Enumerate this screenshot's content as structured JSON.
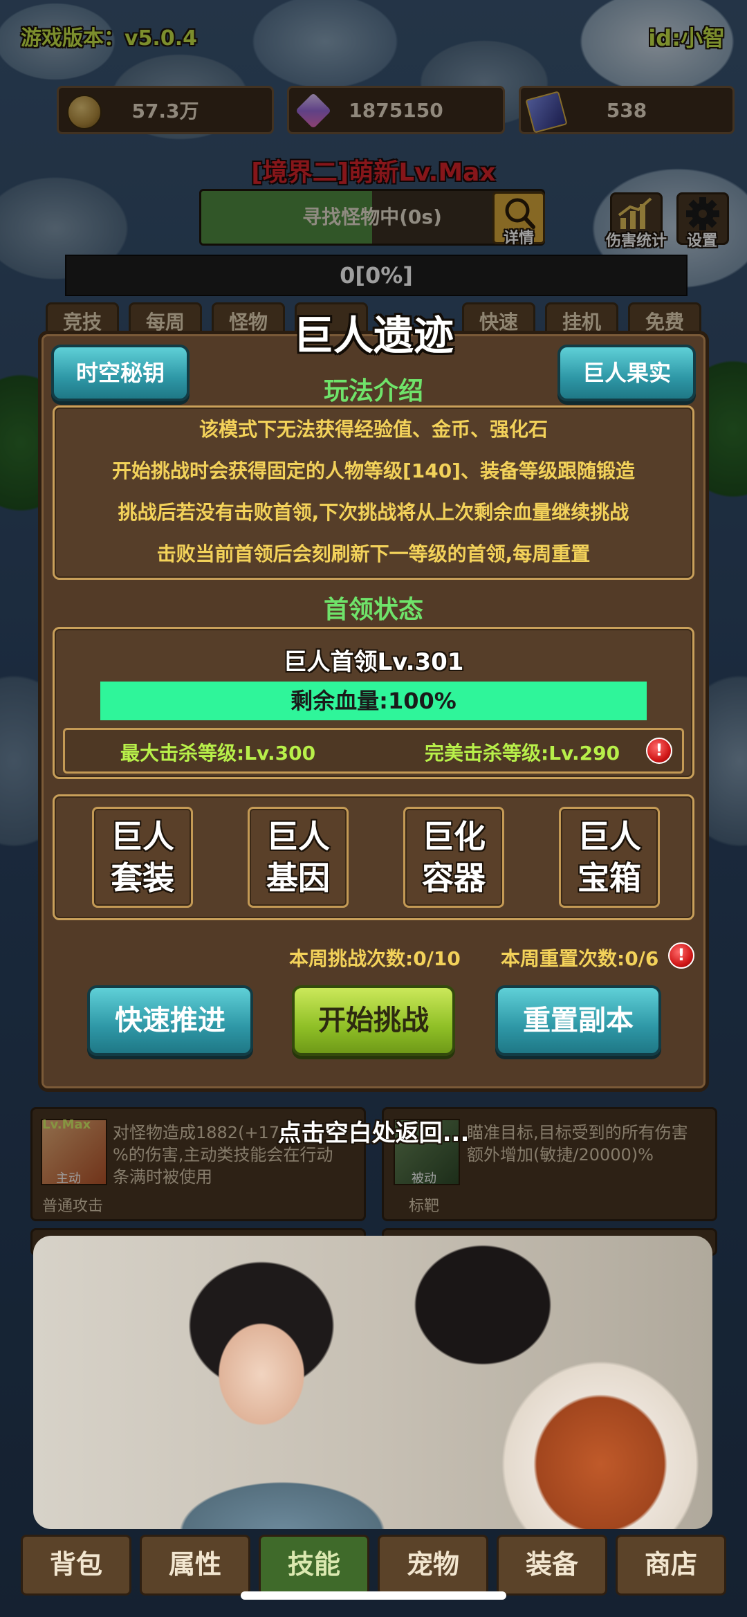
{
  "header": {
    "version_label": "游戏版本：v5.0.4",
    "user_id": "id:小智"
  },
  "resources": [
    {
      "icon": "coin-icon",
      "value": "57.3万"
    },
    {
      "icon": "crystal-icon",
      "value": "1875150"
    },
    {
      "icon": "card-icon",
      "value": "538"
    }
  ],
  "realm_title": "[境界二]萌新Lv.Max",
  "search_bar": {
    "label": "寻找怪物中(0s)",
    "detail_label": "详情",
    "progress_fraction": 0.5
  },
  "top_buttons": {
    "damage_stats": "伤害统计",
    "settings": "设置"
  },
  "progress_text": "0[0%]",
  "tabs": [
    "竞技",
    "每周",
    "怪物",
    "",
    "快速",
    "挂机",
    "免费"
  ],
  "dialog": {
    "title": "巨人遗迹",
    "left_button": "时空秘钥",
    "right_button": "巨人果实",
    "intro_title": "玩法介绍",
    "intro_lines": [
      "该模式下无法获得经验值、金币、强化石",
      "开始挑战时会获得固定的人物等级[140]、装备等级跟随锻造",
      "挑战后若没有击败首领,下次挑战将从上次剩余血量继续挑战",
      "击败当前首领后会刻刷新下一等级的首领,每周重置"
    ],
    "boss_status_title": "首领状态",
    "boss_name": "巨人首领Lv.301",
    "hp_label": "剩余血量:100%",
    "hp_fraction": 1.0,
    "max_kill": "最大击杀等级:Lv.300",
    "perfect_kill": "完美击杀等级:Lv.290",
    "features": [
      {
        "line1": "巨人",
        "line2": "套装"
      },
      {
        "line1": "巨人",
        "line2": "基因"
      },
      {
        "line1": "巨化",
        "line2": "容器"
      },
      {
        "line1": "巨人",
        "line2": "宝箱"
      }
    ],
    "weekly_challenges": "本周挑战次数:0/10",
    "weekly_resets": "本周重置次数:0/6",
    "fast_advance": "快速推进",
    "start_challenge": "开始挑战",
    "reset_dungeon": "重置副本"
  },
  "dismiss_hint": "点击空白处返回...",
  "skills": [
    {
      "badge": "Lv.Max",
      "type": "主动",
      "desc": "对怪物造成1882(+17",
      "desc2": "%的伤害,主动类技能会在行动",
      "desc3": "条满时被使用",
      "name": "普通攻击"
    },
    {
      "badge": "",
      "type": "被动",
      "desc": "瞄准目标,目标受到的所有伤害",
      "desc2": "额外增加(敏捷/20000)%",
      "desc3": "",
      "name": "标靶"
    }
  ],
  "bottom_tabs": [
    "背包",
    "属性",
    "技能",
    "宠物",
    "装备",
    "商店"
  ],
  "colors": {
    "panel": "#533b27",
    "gold_text": "#f3d25a",
    "intro_title": "#6fe36a",
    "hp_bar": "#2ff59a",
    "teal_button": "#2e97a6",
    "green_button": "#8fbf26",
    "realm_red": "#d8252a"
  }
}
